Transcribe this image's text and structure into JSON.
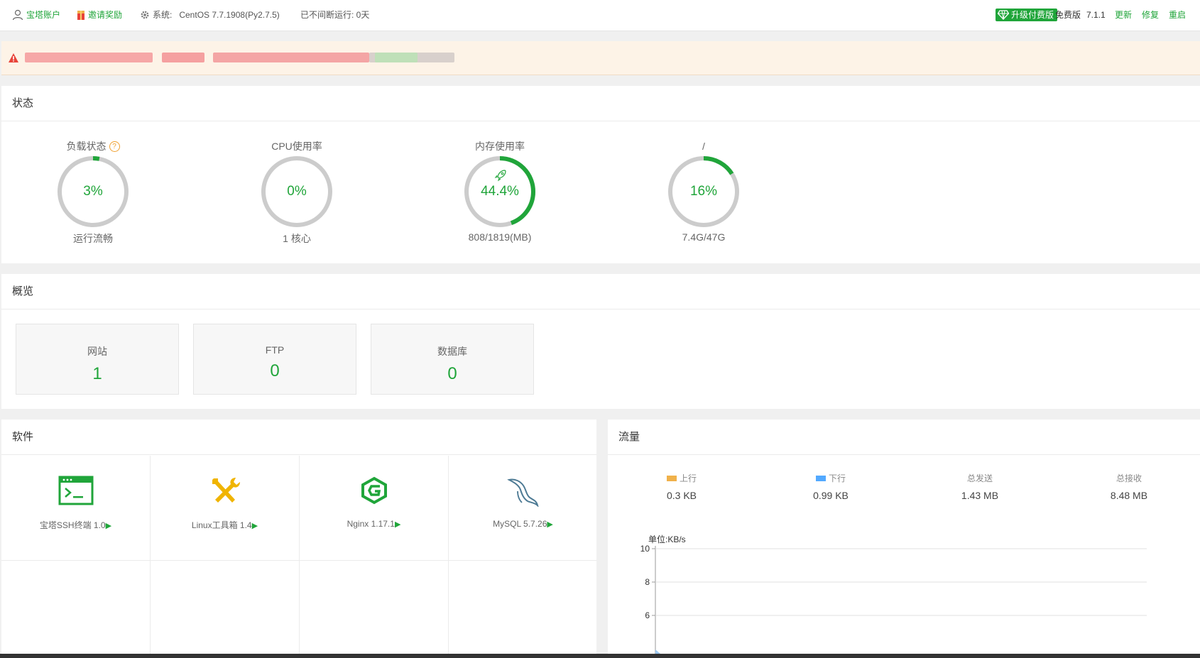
{
  "topbar": {
    "account": "宝塔账户",
    "invite": "邀请奖励",
    "system_label": "系统:",
    "system_value": "CentOS 7.7.1908(Py2.7.5)",
    "uptime": "已不间断运行: 0天",
    "upgrade": "升级付费版",
    "edition": "免费版",
    "version": "7.1.1",
    "update": "更新",
    "repair": "修复",
    "restart": "重启"
  },
  "status": {
    "title": "状态",
    "gauges": [
      {
        "label": "负载状态",
        "value": "3%",
        "sub": "运行流畅",
        "percent": 3
      },
      {
        "label": "CPU使用率",
        "value": "0%",
        "sub": "1 核心",
        "percent": 0
      },
      {
        "label": "内存使用率",
        "value": "44.4%",
        "sub": "808/1819(MB)",
        "percent": 44.4
      },
      {
        "label": "/",
        "value": "16%",
        "sub": "7.4G/47G",
        "percent": 16
      }
    ]
  },
  "overview": {
    "title": "概览",
    "cards": [
      {
        "label": "网站",
        "value": "1"
      },
      {
        "label": "FTP",
        "value": "0"
      },
      {
        "label": "数据库",
        "value": "0"
      }
    ]
  },
  "software": {
    "title": "软件",
    "items": [
      {
        "name": "宝塔SSH终端 1.0",
        "icon": "terminal-icon"
      },
      {
        "name": "Linux工具箱 1.4",
        "icon": "tools-icon"
      },
      {
        "name": "Nginx 1.17.1",
        "icon": "nginx-icon"
      },
      {
        "name": "MySQL 5.7.26",
        "icon": "mysql-icon"
      }
    ]
  },
  "traffic": {
    "title": "流量",
    "stats": [
      {
        "label": "上行",
        "value": "0.3 KB",
        "color": "#f0b14a"
      },
      {
        "label": "下行",
        "value": "0.99 KB",
        "color": "#52a9ff"
      },
      {
        "label": "总发送",
        "value": "1.43 MB"
      },
      {
        "label": "总接收",
        "value": "8.48 MB"
      }
    ],
    "unit": "单位:KB/s"
  },
  "chart_data": {
    "type": "line",
    "ylabel": "单位:KB/s",
    "y_ticks": [
      10,
      8,
      6
    ],
    "ylim": [
      4,
      10
    ],
    "grid": true,
    "series": []
  }
}
